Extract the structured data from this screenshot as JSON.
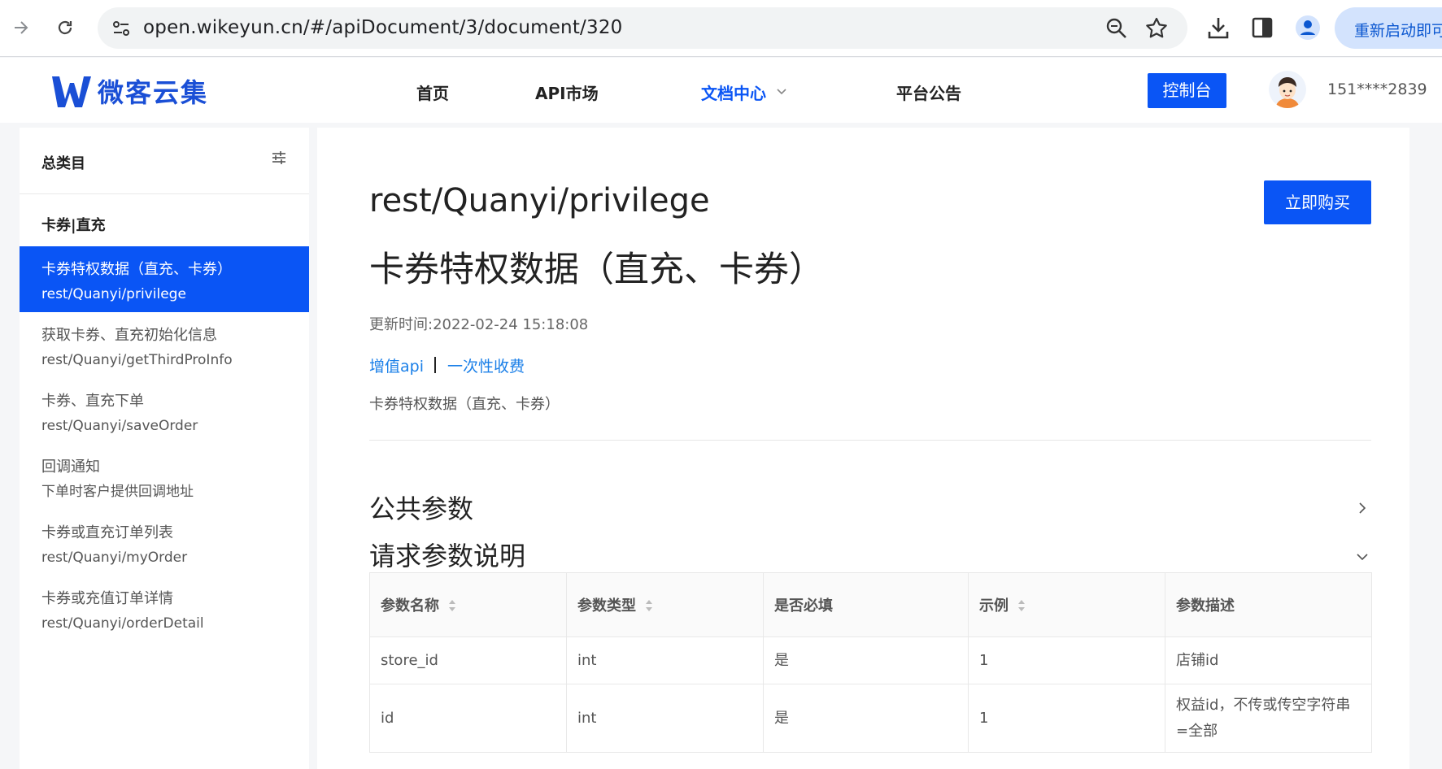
{
  "browser": {
    "url": "open.wikeyun.cn/#/apiDocument/3/document/320",
    "relaunch_label": "重新启动即可"
  },
  "site": {
    "logo_text": "微客云集",
    "nav": [
      {
        "label": "首页"
      },
      {
        "label": "API市场"
      },
      {
        "label": "文档中心",
        "active": true
      },
      {
        "label": "平台公告"
      }
    ],
    "console_label": "控制台",
    "username": "151****2839"
  },
  "sidebar": {
    "title": "总类目",
    "group": "卡券|直充",
    "items": [
      {
        "line1": "卡券特权数据（直充、卡券）",
        "line2": "rest/Quanyi/privilege",
        "active": true
      },
      {
        "line1": "获取卡券、直充初始化信息",
        "line2": "rest/Quanyi/getThirdProInfo"
      },
      {
        "line1": "卡券、直充下单",
        "line2": "rest/Quanyi/saveOrder"
      },
      {
        "line1": "回调通知",
        "line2": "下单时客户提供回调地址"
      },
      {
        "line1": "卡券或直充订单列表",
        "line2": "rest/Quanyi/myOrder"
      },
      {
        "line1": "卡券或充值订单详情",
        "line2": "rest/Quanyi/orderDetail"
      }
    ]
  },
  "main": {
    "api_path": "rest/Quanyi/privilege",
    "buy_label": "立即购买",
    "api_title": "卡券特权数据（直充、卡券）",
    "update_time": "更新时间:2022-02-24 15:18:08",
    "tag1": "增值api",
    "tag2": "一次性收费",
    "description": "卡券特权数据（直充、卡券）",
    "section_public": "公共参数",
    "section_request": "请求参数说明",
    "table": {
      "headers": [
        "参数名称",
        "参数类型",
        "是否必填",
        "示例",
        "参数描述"
      ],
      "rows": [
        [
          "store_id",
          "int",
          "是",
          "1",
          "店铺id"
        ],
        [
          "id",
          "int",
          "是",
          "1",
          "权益id，不传或传空字符串=全部"
        ]
      ]
    }
  },
  "colors": {
    "accent": "#0a55f5",
    "link": "#1a7fe8"
  }
}
